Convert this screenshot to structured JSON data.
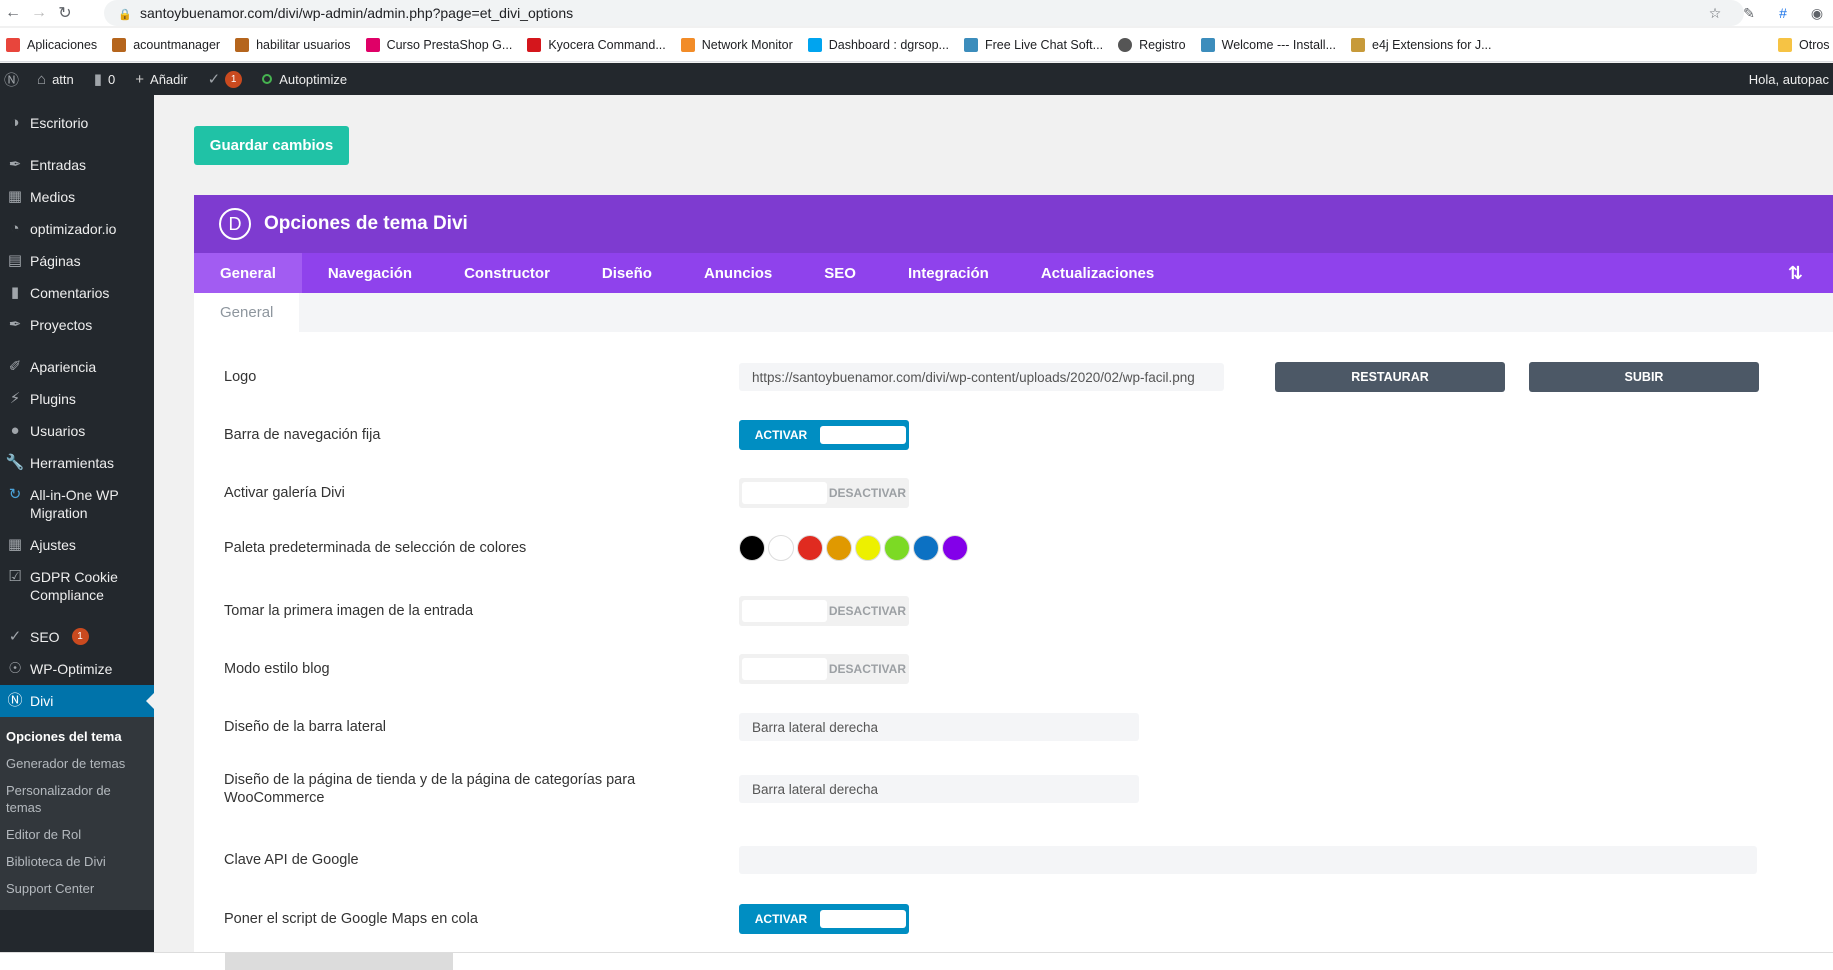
{
  "browser": {
    "url": "santoybuenamor.com/divi/wp-admin/admin.php?page=et_divi_options",
    "bookmarks": [
      {
        "label": "Aplicaciones",
        "color": "#e8453c"
      },
      {
        "label": "acountmanager",
        "color": "#b5651d"
      },
      {
        "label": "habilitar usuarios",
        "color": "#b5651d"
      },
      {
        "label": "Curso PrestaShop G...",
        "color": "#df0067"
      },
      {
        "label": "Kyocera Command...",
        "color": "#d4161c"
      },
      {
        "label": "Network Monitor",
        "color": "#f28c28"
      },
      {
        "label": "Dashboard : dgrsop...",
        "color": "#00a4ef"
      },
      {
        "label": "Free Live Chat Soft...",
        "color": "#3c8dbc"
      },
      {
        "label": "Registro",
        "color": "#555555"
      },
      {
        "label": "Welcome --- Install...",
        "color": "#3c8dbc"
      },
      {
        "label": "e4j Extensions for J...",
        "color": "#c79a3a"
      },
      {
        "label": "Otros",
        "color": "#f6c344"
      }
    ]
  },
  "adminbar": {
    "site": "attn",
    "comments": "0",
    "add": "Añadir",
    "seo_count": "1",
    "autoptimize": "Autoptimize",
    "greeting": "Hola, autopac"
  },
  "sidebar": {
    "items": [
      {
        "label": "Escritorio",
        "icon": "dashboard-icon"
      },
      {
        "label": "Entradas",
        "icon": "pin-icon"
      },
      {
        "label": "Medios",
        "icon": "media-icon"
      },
      {
        "label": "optimizador.io",
        "icon": "gauge-icon"
      },
      {
        "label": "Páginas",
        "icon": "page-icon"
      },
      {
        "label": "Comentarios",
        "icon": "comment-icon"
      },
      {
        "label": "Proyectos",
        "icon": "pin-icon"
      },
      {
        "label": "Apariencia",
        "icon": "brush-icon"
      },
      {
        "label": "Plugins",
        "icon": "plugin-icon"
      },
      {
        "label": "Usuarios",
        "icon": "user-icon"
      },
      {
        "label": "Herramientas",
        "icon": "wrench-icon"
      },
      {
        "label": "All-in-One WP Migration",
        "icon": "migration-icon"
      },
      {
        "label": "Ajustes",
        "icon": "settings-icon"
      },
      {
        "label": "GDPR Cookie Compliance",
        "icon": "check-icon"
      },
      {
        "label": "SEO",
        "icon": "yoast-icon",
        "badge": "1"
      },
      {
        "label": "WP-Optimize",
        "icon": "optimize-icon"
      },
      {
        "label": "Divi",
        "icon": "divi-icon"
      }
    ],
    "submenu": [
      "Opciones del tema",
      "Generador de temas",
      "Personalizador de temas",
      "Editor de Rol",
      "Biblioteca de Divi",
      "Support Center"
    ]
  },
  "main": {
    "save_label": "Guardar cambios",
    "panel_title": "Opciones de tema Divi",
    "logo_letter": "D",
    "tabs": [
      "General",
      "Navegación",
      "Constructor",
      "Diseño",
      "Anuncios",
      "SEO",
      "Integración",
      "Actualizaciones"
    ],
    "subtab": "General",
    "settings": {
      "logo_label": "Logo",
      "logo_value": "https://santoybuenamor.com/divi/wp-content/uploads/2020/02/wp-facil.png",
      "restore_label": "RESTAURAR",
      "upload_label": "SUBIR",
      "fixed_nav_label": "Barra de navegación fija",
      "gallery_label": "Activar galería Divi",
      "palette_label": "Paleta predeterminada de selección de colores",
      "first_image_label": "Tomar la primera imagen de la entrada",
      "blog_style_label": "Modo estilo blog",
      "sidebar_layout_label": "Diseño de la barra lateral",
      "sidebar_layout_value": "Barra lateral derecha",
      "shop_layout_label": "Diseño de la página de tienda y de la página de categorías para WooCommerce",
      "shop_layout_value": "Barra lateral derecha",
      "google_api_label": "Clave API de Google",
      "google_api_value": "",
      "google_maps_label": "Poner el script de Google Maps en cola",
      "on_label": "ACTIVAR",
      "off_label": "DESACTIVAR"
    },
    "palette": [
      "#000000",
      "#ffffff",
      "#e02b20",
      "#e09900",
      "#edf000",
      "#7cda24",
      "#0c71c3",
      "#8300e9"
    ]
  }
}
